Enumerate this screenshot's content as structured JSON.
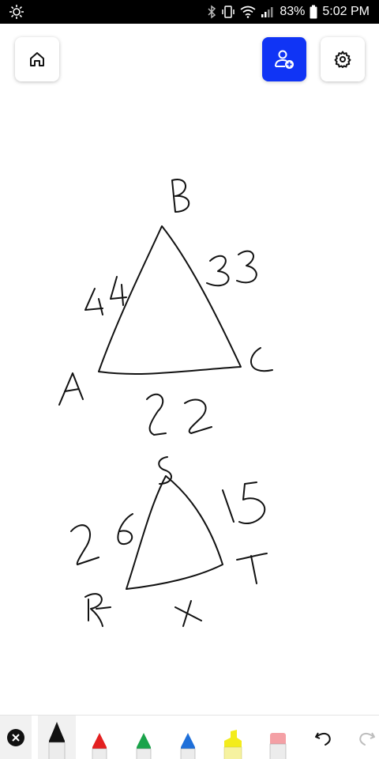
{
  "status_bar": {
    "battery_percent": "83%",
    "time": "5:02 PM"
  },
  "icons": {
    "home": "home-icon",
    "invite": "person-add-icon",
    "settings": "gear-icon",
    "close": "close-icon",
    "undo": "undo-icon",
    "redo": "redo-icon"
  },
  "colors": {
    "accent": "#1034f5",
    "pen_black": "#111111",
    "pen_red": "#e32020",
    "pen_green": "#1aa34a",
    "pen_blue": "#1e6fd9",
    "highlighter_yellow": "#f3ec1c",
    "eraser_pink": "#f4a0a5"
  },
  "canvas_labels": {
    "triangle1_vertex_b": "B",
    "triangle1_vertex_a": "A",
    "triangle1_vertex_c": "C",
    "triangle1_side_ab": "44",
    "triangle1_side_bc": "33",
    "triangle1_side_ac": "22",
    "triangle2_vertex_s": "S",
    "triangle2_vertex_r": "R",
    "triangle2_vertex_t": "T",
    "triangle2_side_rs": "26",
    "triangle2_side_st": "15",
    "triangle2_side_rt": "x"
  }
}
